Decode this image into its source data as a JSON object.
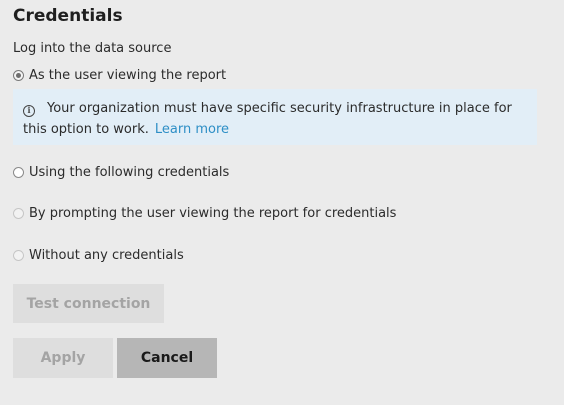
{
  "dialog": {
    "title": "Credentials",
    "subtitle": "Log into the data source"
  },
  "options": [
    {
      "label": "As the user viewing the report",
      "selected": true,
      "enabled": true
    },
    {
      "label": "Using the following credentials",
      "selected": false,
      "enabled": true
    },
    {
      "label": "By prompting the user viewing the report for credentials",
      "selected": false,
      "enabled": false
    },
    {
      "label": "Without any credentials",
      "selected": false,
      "enabled": false
    }
  ],
  "info": {
    "icon": "info-icon",
    "message": "Your organization must have specific security infrastructure in place for this option to work.",
    "link_label": "Learn more"
  },
  "buttons": {
    "test_connection": "Test connection",
    "apply": "Apply",
    "cancel": "Cancel"
  },
  "colors": {
    "background": "#ebebeb",
    "info_background": "#e2eef7",
    "link": "#2e8fc6",
    "cancel_button": "#b6b6b6",
    "disabled_button": "#dedede"
  }
}
